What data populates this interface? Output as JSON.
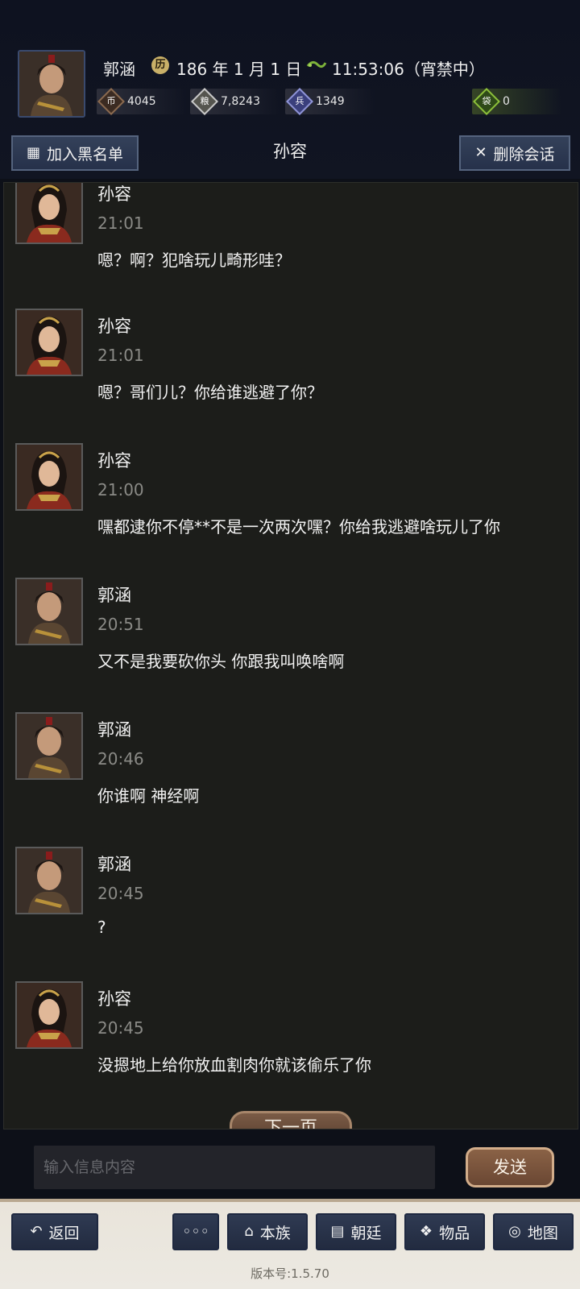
{
  "header": {
    "player_name": "郭涵",
    "date_icon": "calendar-seal-icon",
    "date": "186 年 1 月 1 日",
    "time": "11:53:06（宵禁中）",
    "resources": [
      {
        "icon": "coin-icon",
        "value": "4045"
      },
      {
        "icon": "grain-icon",
        "value": "7,8243"
      },
      {
        "icon": "soldier-icon",
        "value": "1349"
      },
      {
        "icon": "pouch-icon",
        "value": "0"
      }
    ]
  },
  "chat": {
    "title": "孙容",
    "blacklist_label": "加入黑名单",
    "delete_label": "删除会话",
    "messages": [
      {
        "sender": "孙容",
        "time": "21:01",
        "text": "嗯？啊？犯啥玩儿畸形哇？"
      },
      {
        "sender": "孙容",
        "time": "21:01",
        "text": "嗯？哥们儿？你给谁逃避了你？"
      },
      {
        "sender": "孙容",
        "time": "21:00",
        "text": "嘿都逮你不停**不是一次两次嘿？你给我逃避啥玩儿了你"
      },
      {
        "sender": "郭涵",
        "time": "20:51",
        "text": "又不是我要砍你头 你跟我叫唤啥啊"
      },
      {
        "sender": "郭涵",
        "time": "20:46",
        "text": "你谁啊 神经啊"
      },
      {
        "sender": "郭涵",
        "time": "20:45",
        "text": "?"
      },
      {
        "sender": "孙容",
        "time": "20:45",
        "text": "没摁地上给你放血割肉你就该偷乐了你"
      }
    ],
    "next_page_label": "下一页"
  },
  "input": {
    "placeholder": "输入信息内容",
    "value": "",
    "send_label": "发送"
  },
  "nav": {
    "back": "返回",
    "more": "◦◦◦",
    "clan": "本族",
    "court": "朝廷",
    "items": "物品",
    "map": "地图"
  },
  "version": "版本号:1.5.70",
  "colors": {
    "panel_bg": "#1c1d1a",
    "button_blue": "#2f3a52",
    "send_brown": "#7a5640",
    "nav_bg": "#ece9e2"
  }
}
